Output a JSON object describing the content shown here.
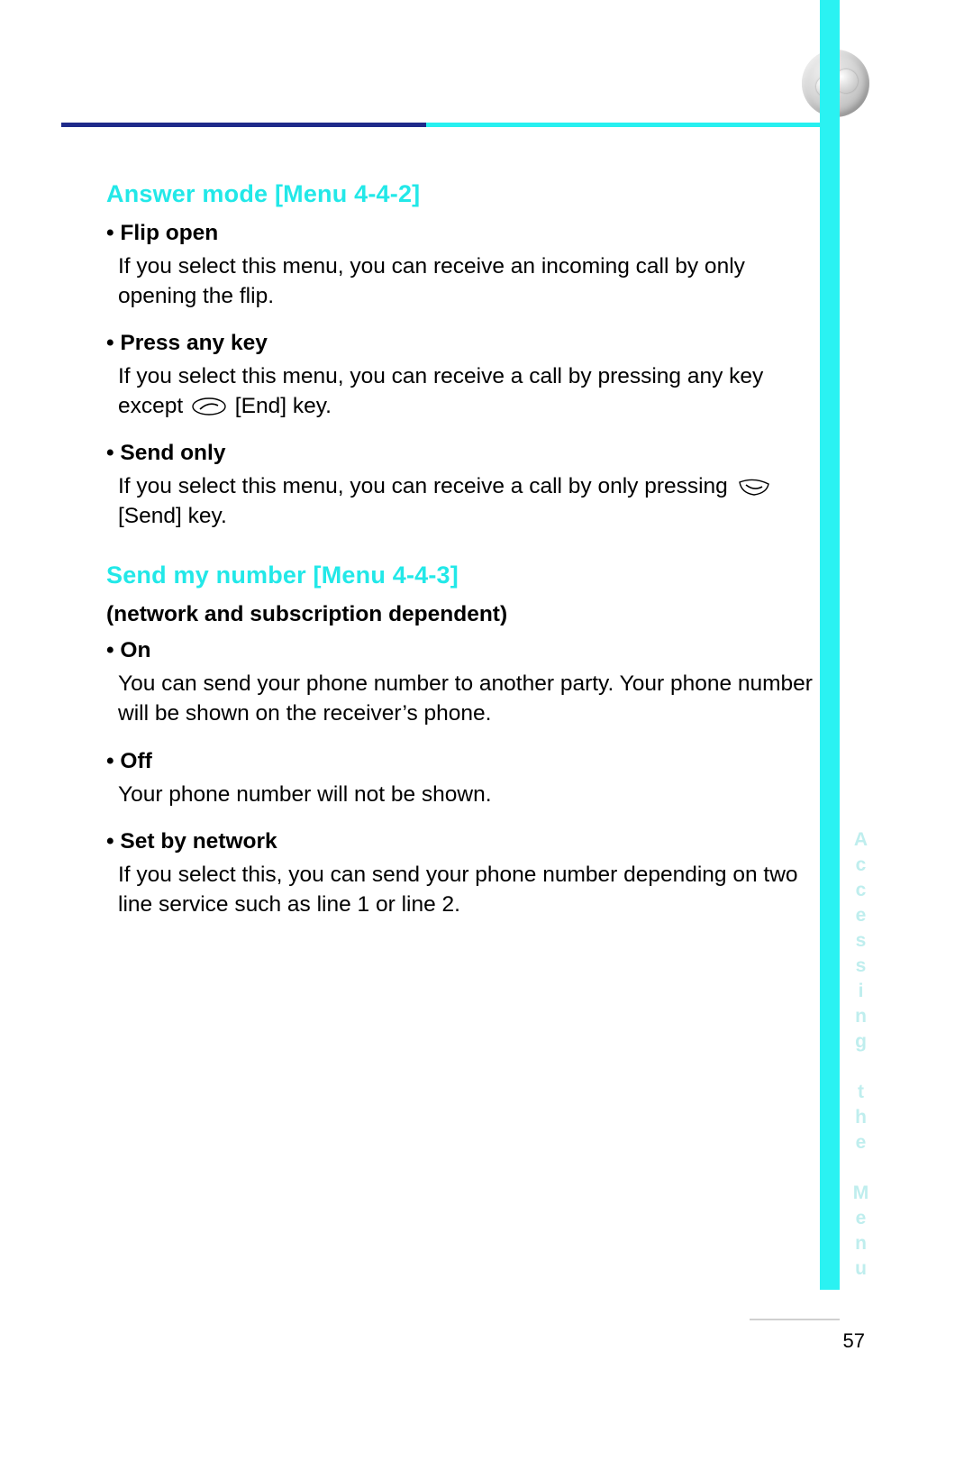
{
  "side_label": "Accessing the Menu",
  "page_number": "57",
  "sections": [
    {
      "heading": "Answer mode [Menu 4-4-2]",
      "subnote": "",
      "items": [
        {
          "title": "• Flip open",
          "body_pre": "If you select this menu, you can receive an incoming call by only opening the flip.",
          "icon": "",
          "body_post": ""
        },
        {
          "title": "• Press any key",
          "body_pre": "If you select this menu, you can receive a call by pressing any key except ",
          "icon": "end-key",
          "body_post": " [End] key."
        },
        {
          "title": "• Send only",
          "body_pre": "If you select this menu, you can receive a call by only pressing ",
          "icon": "send-key",
          "body_post": " [Send] key."
        }
      ]
    },
    {
      "heading": "Send my number [Menu 4-4-3]",
      "subnote": "(network and subscription dependent)",
      "items": [
        {
          "title": "• On",
          "body_pre": "You can send your phone number to another party. Your phone number will be shown on the receiver’s phone.",
          "icon": "",
          "body_post": ""
        },
        {
          "title": "• Off",
          "body_pre": "Your phone number will not be shown.",
          "icon": "",
          "body_post": ""
        },
        {
          "title": "• Set by network",
          "body_pre": "If you select this, you can send your phone number depending on two line service such as line 1 or line 2.",
          "icon": "",
          "body_post": ""
        }
      ]
    }
  ]
}
